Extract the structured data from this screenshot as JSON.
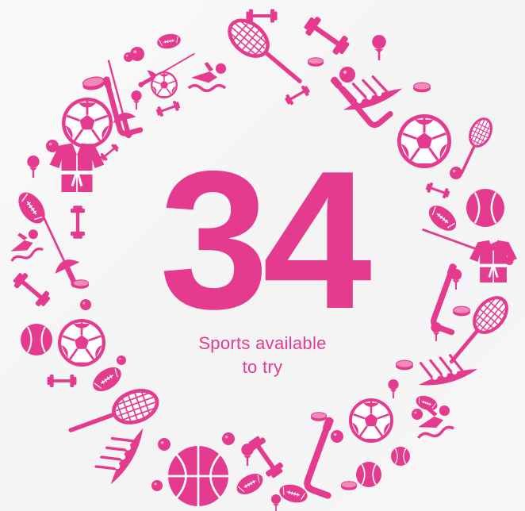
{
  "stat": {
    "value": "34",
    "caption_line1": "Sports available",
    "caption_line2": "to try"
  },
  "colors": {
    "accent": "#e43b8e",
    "background": "#f5f5f6"
  },
  "icons": [
    "dumbbell-icon",
    "tennis-racket-icon",
    "hockey-stick-icon",
    "football-icon",
    "soccer-ball-icon",
    "swimmer-icon",
    "rowing-boat-icon",
    "fencing-icon",
    "karate-gi-icon",
    "baseball-icon",
    "golf-ball-icon",
    "hockey-puck-icon",
    "basketball-icon"
  ]
}
